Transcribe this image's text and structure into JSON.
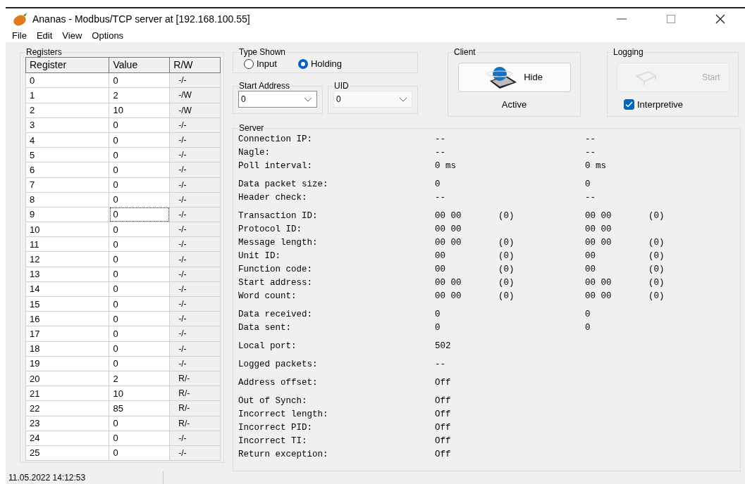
{
  "window": {
    "title": "Ananas - Modbus/TCP server at [192.168.100.55]"
  },
  "menu": [
    "File",
    "Edit",
    "View",
    "Options"
  ],
  "registers": {
    "title": "Registers",
    "columns": [
      "Register",
      "Value",
      "R/W"
    ],
    "rows": [
      {
        "register": "0",
        "value": "0",
        "rw": "-/-",
        "focused": false
      },
      {
        "register": "1",
        "value": "2",
        "rw": "-/W",
        "focused": false
      },
      {
        "register": "2",
        "value": "10",
        "rw": "-/W",
        "focused": false
      },
      {
        "register": "3",
        "value": "0",
        "rw": "-/-",
        "focused": false
      },
      {
        "register": "4",
        "value": "0",
        "rw": "-/-",
        "focused": false
      },
      {
        "register": "5",
        "value": "0",
        "rw": "-/-",
        "focused": false
      },
      {
        "register": "6",
        "value": "0",
        "rw": "-/-",
        "focused": false
      },
      {
        "register": "7",
        "value": "0",
        "rw": "-/-",
        "focused": false
      },
      {
        "register": "8",
        "value": "0",
        "rw": "-/-",
        "focused": false
      },
      {
        "register": "9",
        "value": "0",
        "rw": "-/-",
        "focused": true
      },
      {
        "register": "10",
        "value": "0",
        "rw": "-/-",
        "focused": false
      },
      {
        "register": "11",
        "value": "0",
        "rw": "-/-",
        "focused": false
      },
      {
        "register": "12",
        "value": "0",
        "rw": "-/-",
        "focused": false
      },
      {
        "register": "13",
        "value": "0",
        "rw": "-/-",
        "focused": false
      },
      {
        "register": "14",
        "value": "0",
        "rw": "-/-",
        "focused": false
      },
      {
        "register": "15",
        "value": "0",
        "rw": "-/-",
        "focused": false
      },
      {
        "register": "16",
        "value": "0",
        "rw": "-/-",
        "focused": false
      },
      {
        "register": "17",
        "value": "0",
        "rw": "-/-",
        "focused": false
      },
      {
        "register": "18",
        "value": "0",
        "rw": "-/-",
        "focused": false
      },
      {
        "register": "19",
        "value": "0",
        "rw": "-/-",
        "focused": false
      },
      {
        "register": "20",
        "value": "2",
        "rw": "R/-",
        "focused": false
      },
      {
        "register": "21",
        "value": "10",
        "rw": "R/-",
        "focused": false
      },
      {
        "register": "22",
        "value": "85",
        "rw": "R/-",
        "focused": false
      },
      {
        "register": "23",
        "value": "0",
        "rw": "R/-",
        "focused": false
      },
      {
        "register": "24",
        "value": "0",
        "rw": "-/-",
        "focused": false
      },
      {
        "register": "25",
        "value": "0",
        "rw": "-/-",
        "focused": false
      }
    ]
  },
  "type_shown": {
    "title": "Type Shown",
    "options": [
      {
        "label": "Input",
        "selected": false
      },
      {
        "label": "Holding",
        "selected": true
      }
    ]
  },
  "start_address": {
    "title": "Start Address",
    "value": "0"
  },
  "uid": {
    "title": "UID",
    "value": "0"
  },
  "client": {
    "title": "Client",
    "button": "Hide",
    "status": "Active"
  },
  "logging": {
    "title": "Logging",
    "button": "Start",
    "disabled": true,
    "checkbox": {
      "label": "Interpretive",
      "checked": true
    }
  },
  "server": {
    "title": "Server",
    "groups": [
      [
        {
          "label": "Connection IP:",
          "values": [
            {
              "text": "--"
            },
            {
              "text": "--"
            }
          ]
        },
        {
          "label": "Nagle:",
          "values": [
            {
              "text": "--"
            },
            {
              "text": "--"
            }
          ]
        },
        {
          "label": "Poll interval:",
          "values": [
            {
              "text": "0 ms"
            },
            {
              "text": "0 ms"
            }
          ]
        }
      ],
      [
        {
          "label": "Data packet size:",
          "values": [
            {
              "text": "0"
            },
            {
              "text": "0"
            }
          ]
        },
        {
          "label": "Header check:",
          "values": [
            {
              "text": "--"
            },
            {
              "text": "--"
            }
          ]
        }
      ],
      [
        {
          "label": "Transaction ID:",
          "values": [
            {
              "text": "00 00",
              "dec": "(0)"
            },
            {
              "text": "00 00",
              "dec": "(0)"
            }
          ]
        },
        {
          "label": "Protocol ID:",
          "values": [
            {
              "text": "00 00"
            },
            {
              "text": "00 00"
            }
          ]
        },
        {
          "label": "Message length:",
          "values": [
            {
              "text": "00 00",
              "dec": "(0)"
            },
            {
              "text": "00 00",
              "dec": "(0)"
            }
          ]
        },
        {
          "label": "Unit ID:",
          "values": [
            {
              "text": "00",
              "dec": "(0)"
            },
            {
              "text": "00",
              "dec": "(0)"
            }
          ]
        },
        {
          "label": "Function code:",
          "values": [
            {
              "text": "00",
              "dec": "(0)"
            },
            {
              "text": "00",
              "dec": "(0)"
            }
          ]
        },
        {
          "label": "Start address:",
          "values": [
            {
              "text": "00 00",
              "dec": "(0)"
            },
            {
              "text": "00 00",
              "dec": "(0)"
            }
          ]
        },
        {
          "label": "Word count:",
          "values": [
            {
              "text": "00 00",
              "dec": "(0)"
            },
            {
              "text": "00 00",
              "dec": "(0)"
            }
          ]
        }
      ],
      [
        {
          "label": "Data received:",
          "values": [
            {
              "text": "0"
            },
            {
              "text": "0"
            }
          ]
        },
        {
          "label": "Data sent:",
          "values": [
            {
              "text": "0"
            },
            {
              "text": "0"
            }
          ]
        }
      ],
      [
        {
          "label": "Local port:",
          "values": [
            {
              "text": "502"
            }
          ]
        }
      ],
      [
        {
          "label": "Logged packets:",
          "values": [
            {
              "text": "--"
            }
          ]
        }
      ],
      [
        {
          "label": "Address offset:",
          "values": [
            {
              "text": "Off"
            }
          ]
        }
      ],
      [
        {
          "label": "Out of Synch:",
          "values": [
            {
              "text": "Off"
            }
          ]
        },
        {
          "label": "Incorrect length:",
          "values": [
            {
              "text": "Off"
            }
          ]
        },
        {
          "label": "Incorrect PID:",
          "values": [
            {
              "text": "Off"
            }
          ]
        },
        {
          "label": "Incorrect TI:",
          "values": [
            {
              "text": "Off"
            }
          ]
        },
        {
          "label": "Return exception:",
          "values": [
            {
              "text": "Off"
            }
          ]
        }
      ]
    ]
  },
  "status_bar": [
    "11.05.2022 14:12:53"
  ]
}
